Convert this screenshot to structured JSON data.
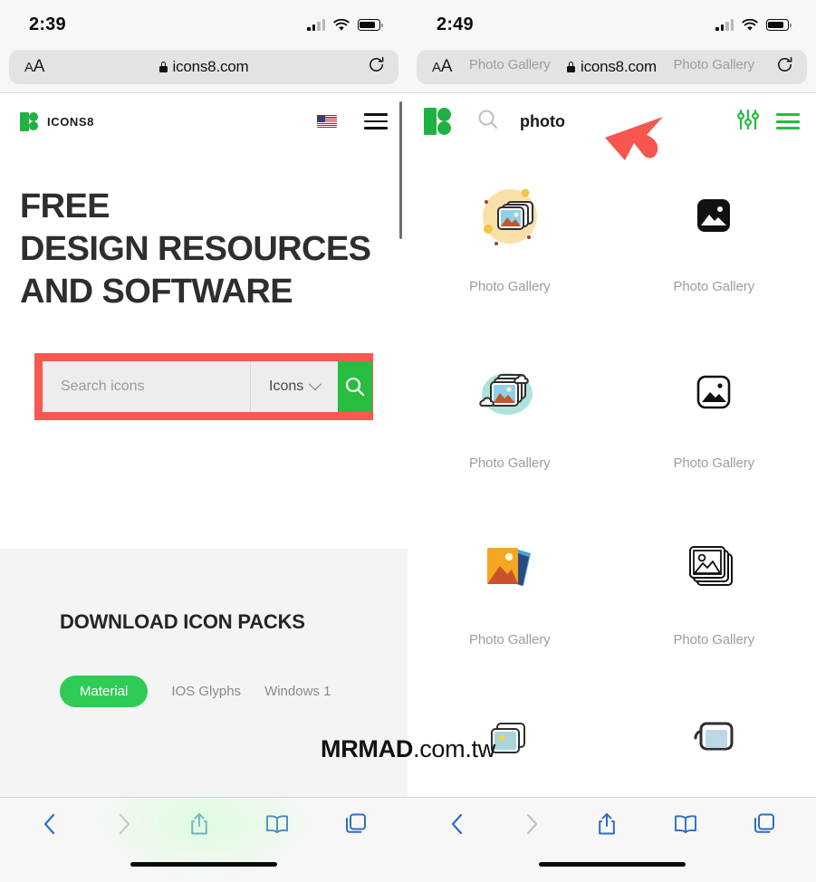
{
  "left": {
    "status": {
      "time": "2:39",
      "signal_icon": "cellular-bars-icon",
      "wifi_icon": "wifi-icon",
      "battery_icon": "battery-icon"
    },
    "urlbar": {
      "aa_label": "A",
      "aa_label_big": "A",
      "lock_icon": "lock-icon",
      "url": "icons8.com",
      "reload_icon": "reload-icon"
    },
    "header": {
      "brand": "ICONS8",
      "logo_icon": "icons8-logo-icon",
      "flag_icon": "us-flag-icon",
      "menu_icon": "hamburger-menu-icon"
    },
    "hero": {
      "line1": "FREE",
      "line2": "DESIGN RESOURCES",
      "line3": "AND SOFTWARE"
    },
    "search": {
      "placeholder": "Search icons",
      "value": "",
      "type_label": "Icons",
      "chevron_icon": "chevron-down-icon",
      "button_icon": "search-icon",
      "highlight_color": "#f8584f",
      "button_color": "#27bd3f"
    },
    "packs": {
      "title": "DOWNLOAD ICON PACKS",
      "tabs": [
        {
          "label": "Material",
          "active": true
        },
        {
          "label": "IOS Glyphs",
          "active": false
        },
        {
          "label": "Windows 1",
          "active": false
        }
      ],
      "active_color": "#2ecc55"
    },
    "toolbar": {
      "back_icon": "chevron-left-icon",
      "forward_icon": "chevron-right-icon",
      "share_icon": "share-icon",
      "bookmarks_icon": "book-icon",
      "tabs_icon": "tabs-icon"
    }
  },
  "right": {
    "status": {
      "time": "2:49",
      "signal_icon": "cellular-bars-icon",
      "wifi_icon": "wifi-icon",
      "battery_icon": "battery-icon"
    },
    "urlbar": {
      "aa_label": "A",
      "aa_label_big": "A",
      "lock_icon": "lock-icon",
      "url": "icons8.com",
      "reload_icon": "reload-icon"
    },
    "header": {
      "logo_icon": "icons8-logo-icon",
      "search_icon": "search-icon",
      "query": "photo",
      "filter_icon": "sliders-filter-icon",
      "menu_icon": "hamburger-menu-icon",
      "menu_color": "#27bd3f"
    },
    "cursor_icon": "red-arrow-cursor-icon",
    "results": [
      {
        "label": "Photo Gallery",
        "style": "clipped-top-left",
        "icon": "photo-gallery-icon"
      },
      {
        "label": "Photo Gallery",
        "style": "clipped-top-right",
        "icon": "photo-gallery-icon"
      },
      {
        "label": "Photo Gallery",
        "style": "color-yellow-circle",
        "icon": "photo-gallery-icon"
      },
      {
        "label": "Photo Gallery",
        "style": "glyph-filled-square",
        "icon": "photo-gallery-icon"
      },
      {
        "label": "Photo Gallery",
        "style": "color-teal-cloud",
        "icon": "photo-gallery-icon"
      },
      {
        "label": "Photo Gallery",
        "style": "glyph-outline-square",
        "icon": "photo-gallery-icon"
      },
      {
        "label": "Photo Gallery",
        "style": "flat-orange-stack",
        "icon": "photo-gallery-icon"
      },
      {
        "label": "Photo Gallery",
        "style": "line-stack",
        "icon": "photo-gallery-icon"
      },
      {
        "label": "",
        "style": "partial-color-photo",
        "icon": "photo-gallery-icon"
      },
      {
        "label": "",
        "style": "partial-line-photo",
        "icon": "photo-gallery-icon"
      }
    ],
    "toolbar": {
      "back_icon": "chevron-left-icon",
      "forward_icon": "chevron-right-icon",
      "share_icon": "share-icon",
      "bookmarks_icon": "book-icon",
      "tabs_icon": "tabs-icon"
    }
  },
  "watermark": {
    "bold": "MRMAD",
    "rest": ".com.tw"
  }
}
